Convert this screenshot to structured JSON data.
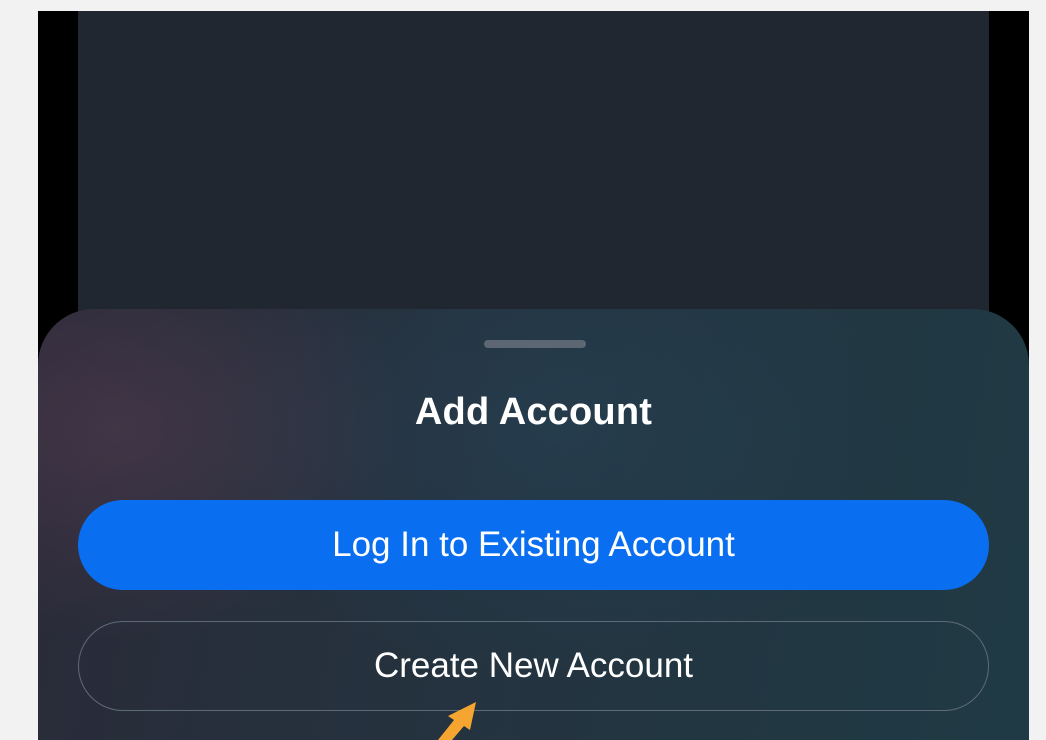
{
  "sheet": {
    "title": "Add Account",
    "primary_button_label": "Log In to Existing Account",
    "secondary_button_label": "Create New Account"
  },
  "annotation": {
    "icon": "arrow-pointer-icon",
    "color": "#f7a531"
  },
  "colors": {
    "primary_button": "#0a6ef0",
    "app_background": "#202730",
    "page_background": "#f2f2f2"
  }
}
